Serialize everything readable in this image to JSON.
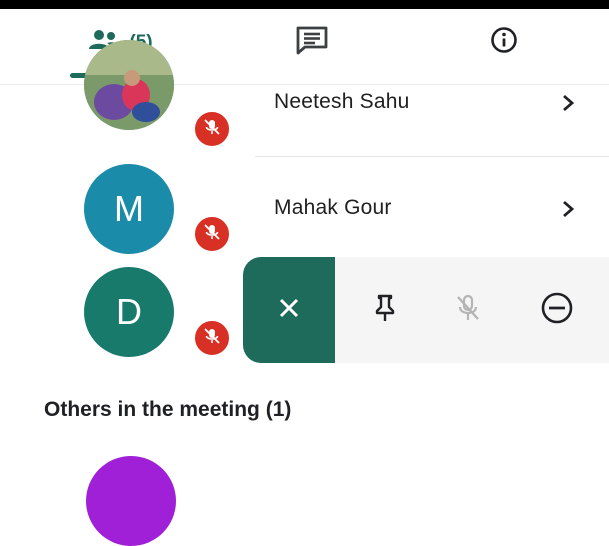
{
  "tabs": {
    "people_count": "(5)",
    "icons": {
      "people": "people-icon",
      "chat": "chat-icon",
      "info": "info-icon"
    }
  },
  "participants": [
    {
      "name": "Neetesh Sahu",
      "avatar_type": "photo",
      "muted": true
    },
    {
      "name": "Mahak Gour",
      "avatar_letter": "M",
      "avatar_color": "#1a8ba8",
      "muted": true
    },
    {
      "avatar_letter": "D",
      "avatar_color": "#177a6b",
      "muted": true
    }
  ],
  "action_tray": {
    "actions": [
      "close-icon",
      "pin-icon",
      "mic-off-icon",
      "remove-icon"
    ]
  },
  "others": {
    "header": "Others in the meeting (1)",
    "avatar_color": "#a020d8"
  },
  "colors": {
    "accent": "#1e6a5b",
    "mute_red": "#d93025"
  }
}
